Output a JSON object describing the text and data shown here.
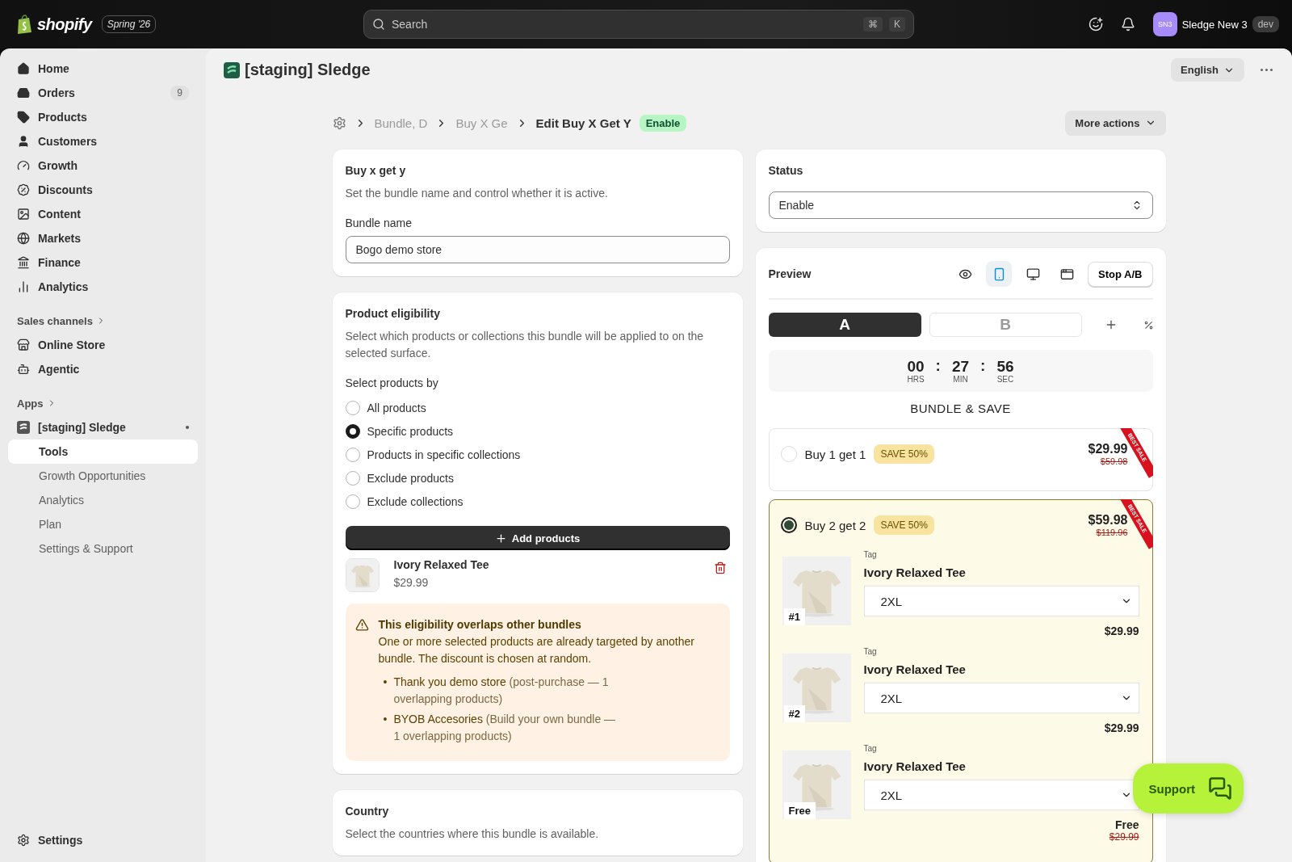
{
  "topbar": {
    "logo": "shopify",
    "edition": "Spring '26",
    "search": {
      "placeholder": "Search",
      "keys": [
        "⌘",
        "K"
      ]
    },
    "account": {
      "initials": "SN3",
      "name": "Sledge New 3",
      "badge": "dev"
    }
  },
  "sidebar": {
    "items": [
      {
        "label": "Home"
      },
      {
        "label": "Orders",
        "count": "9"
      },
      {
        "label": "Products"
      },
      {
        "label": "Customers"
      },
      {
        "label": "Growth"
      },
      {
        "label": "Discounts"
      },
      {
        "label": "Content"
      },
      {
        "label": "Markets"
      },
      {
        "label": "Finance"
      },
      {
        "label": "Analytics"
      }
    ],
    "sales_channels": {
      "heading": "Sales channels",
      "items": [
        {
          "label": "Online Store"
        },
        {
          "label": "Agentic"
        }
      ]
    },
    "apps": {
      "heading": "Apps",
      "app": {
        "label": "[staging] Sledge",
        "children": [
          {
            "label": "Tools",
            "selected": true
          },
          {
            "label": "Growth Opportunities",
            "selected": false
          },
          {
            "label": "Analytics",
            "selected": false
          },
          {
            "label": "Plan",
            "selected": false
          },
          {
            "label": "Settings & Support",
            "selected": false
          }
        ]
      }
    },
    "footer": "Settings"
  },
  "app_header": {
    "title": "[staging] Sledge",
    "language": "English"
  },
  "breadcrumb": {
    "items": [
      "Bundle, D",
      "Buy X Ge"
    ],
    "current": "Edit Buy X Get Y",
    "status": "Enable",
    "more_actions": "More actions"
  },
  "bundle_card": {
    "title": "Buy x get y",
    "description": "Set the bundle name and control whether it is active.",
    "field_label": "Bundle name",
    "field_value": "Bogo demo store"
  },
  "eligibility_card": {
    "title": "Product eligibility",
    "description": "Select which products or collections this bundle will be applied to on the selected surface.",
    "group_label": "Select products by",
    "options": [
      {
        "label": "All products",
        "selected": false
      },
      {
        "label": "Specific products",
        "selected": true
      },
      {
        "label": "Products in specific collections",
        "selected": false
      },
      {
        "label": "Exclude products",
        "selected": false
      },
      {
        "label": "Exclude collections",
        "selected": false
      }
    ],
    "add_button": "Add products",
    "products": [
      {
        "name": "Ivory Relaxed Tee",
        "price": "$29.99"
      }
    ],
    "warning": {
      "title": "This eligibility overlaps other bundles",
      "message": "One or more selected products are already targeted by another bundle. The discount is chosen at random.",
      "items": [
        {
          "marker": "•",
          "name": "Thank you demo store",
          "detail": "(post-purchase — 1 overlapping products)"
        },
        {
          "marker": "•",
          "name": "BYOB Accesories",
          "detail": "(Build your own bundle — 1 overlapping products)"
        }
      ]
    }
  },
  "country_card": {
    "title": "Country",
    "description": "Select the countries where this bundle is available."
  },
  "status_card": {
    "title": "Status",
    "value": "Enable"
  },
  "preview_card": {
    "title": "Preview",
    "devices": [
      {
        "selected": false
      },
      {
        "selected": true
      },
      {
        "selected": false
      },
      {
        "selected": false
      }
    ],
    "stop_button": "Stop A/B",
    "variants": [
      {
        "label": "A",
        "selected": true
      },
      {
        "label": "B",
        "selected": false
      }
    ],
    "timer": {
      "units": [
        {
          "value": "00",
          "unit": "HRS"
        },
        {
          "value": "27",
          "unit": "MIN"
        },
        {
          "value": "56",
          "unit": "SEC"
        }
      ],
      "separators": [
        ":",
        ":"
      ]
    },
    "heading": "BUNDLE & SAVE",
    "offers": [
      {
        "label": "Buy 1 get 1",
        "badge": "SAVE 50%",
        "price": "$29.99",
        "compare_price": "$59.98",
        "ribbon": "BEST SALE",
        "selected": false
      },
      {
        "label": "Buy 2 get 2",
        "badge": "SAVE 50%",
        "price": "$59.98",
        "compare_price": "$119.96",
        "ribbon": "BEST SALE",
        "selected": true,
        "items": [
          {
            "badge": "#1",
            "tag": "Tag",
            "name": "Ivory Relaxed Tee",
            "option": "2XL",
            "price": "$29.99"
          },
          {
            "badge": "#2",
            "tag": "Tag",
            "name": "Ivory Relaxed Tee",
            "option": "2XL",
            "price": "$29.99"
          },
          {
            "badge": "Free",
            "tag": "Tag",
            "name": "Ivory Relaxed Tee",
            "option": "2XL",
            "price": "Free",
            "compare_price": "$29.99"
          }
        ]
      }
    ]
  },
  "support_button": "Support"
}
